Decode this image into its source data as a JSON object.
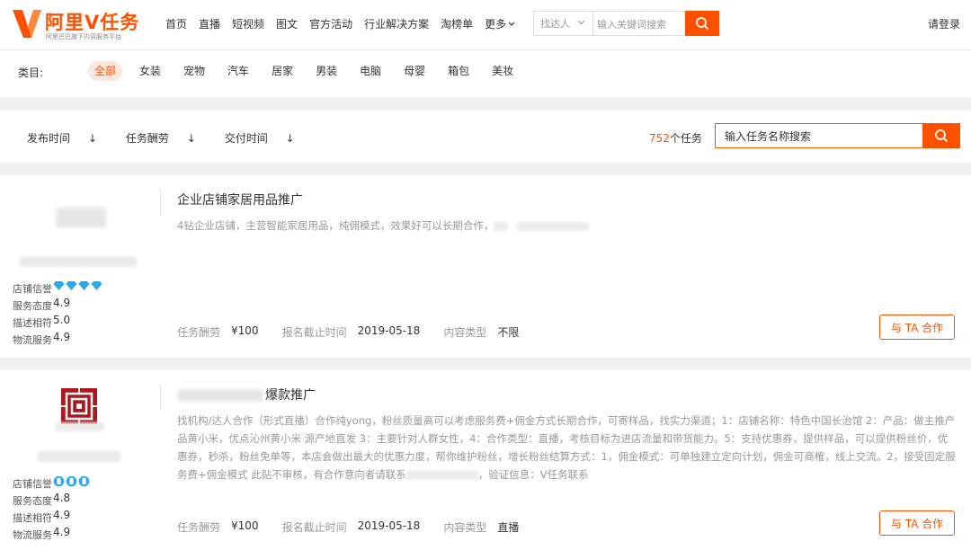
{
  "header": {
    "logo_name": "阿里V任务",
    "logo_sub": "阿里巴巴旗下内容服务平台",
    "nav": [
      "首页",
      "直播",
      "短视频",
      "图文",
      "官方活动",
      "行业解决方案",
      "淘榜单"
    ],
    "more_label": "更多",
    "search": {
      "type_label": "找达人",
      "placeholder": "输入关键词搜索"
    },
    "login_label": "请登录"
  },
  "categories": {
    "label": "类目:",
    "items": [
      "全部",
      "女装",
      "宠物",
      "汽车",
      "居家",
      "男装",
      "电脑",
      "母婴",
      "箱包",
      "美妆"
    ],
    "active": "全部"
  },
  "filters": {
    "sorts": [
      {
        "label": "发布时间",
        "arrow": "↓",
        "active": true
      },
      {
        "label": "任务酬劳",
        "arrow": "↓",
        "active": false
      },
      {
        "label": "交付时间",
        "arrow": "↓",
        "active": false
      }
    ],
    "count_num": "752",
    "count_suffix": "个任务",
    "task_search_placeholder": "输入任务名称搜索"
  },
  "tasks": [
    {
      "title": "企业店铺家居用品推广",
      "desc": "4钻企业店铺，主营智能家居用品，纯佣模式，效果好可以长期合作，",
      "ratings": [
        {
          "k": "店铺信誉",
          "gems": 4,
          "gem_color": "#2ba8e6"
        },
        {
          "k": "服务态度",
          "v": "4.9"
        },
        {
          "k": "描述相符",
          "v": "5.0"
        },
        {
          "k": "物流服务",
          "v": "4.9"
        }
      ],
      "reward_label": "任务酬劳",
      "reward_value": "¥100",
      "deadline_label": "报名截止时间",
      "deadline_value": "2019-05-18",
      "content_label": "内容类型",
      "content_value": "不限",
      "coop_label": "与 TA 合作"
    },
    {
      "title_suffix": "爆款推广",
      "desc_a": "找机构/达人合作（形式直播）合作纯yong，粉丝质量高可以考虑服务费+佣金方式长期合作，可寄样品，找实力渠道；1：店铺名称：特色中国长治馆 2：产品：做主推产品黄小米，优点沁州黄小米 源产地直发 3：主要针对人群女性，4：合作类型：直播，考核目标为进店流量和带货能力。5：支持优惠券，提供样品，可以提供粉丝价，优惠券，秒杀，粉丝免单等，本店会做出最大的优惠力度，帮你维护粉丝，增长粉丝结算方式：1，佣金模式：可单独建立定向计划，佣金可商榷，线上交流。2，接受固定服务费+佣金模式 此贴不审核，有合作意向者请联系",
      "desc_b": "，验证信息：V任务联系",
      "ratings": [
        {
          "k": "店铺信誉",
          "gems": 3,
          "gem_color": "#2ba8e6"
        },
        {
          "k": "服务态度",
          "v": "4.8"
        },
        {
          "k": "描述相符",
          "v": "4.9"
        },
        {
          "k": "物流服务",
          "v": "4.9"
        }
      ],
      "reward_label": "任务酬劳",
      "reward_value": "¥100",
      "deadline_label": "报名截止时间",
      "deadline_value": "2019-05-18",
      "content_label": "内容类型",
      "content_value": "直播",
      "coop_label": "与 TA 合作"
    }
  ],
  "colors": {
    "accent": "#ff5000",
    "accent_light": "#fde7dd",
    "gem": "#2ba8e6"
  }
}
